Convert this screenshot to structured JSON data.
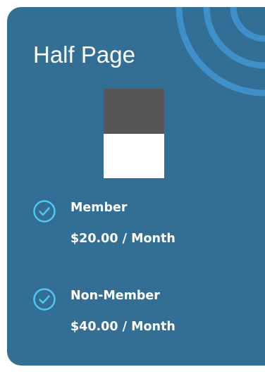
{
  "card": {
    "title": "Half Page",
    "colors": {
      "background": "#336f94",
      "accent": "#4fc6ef",
      "rings": "#3f8fc8",
      "preview_filled": "#555555",
      "preview_blank": "#ffffff"
    },
    "preview": {
      "filled_fraction": 0.5
    },
    "prices": [
      {
        "tier": "Member",
        "price": "$20.00 / Month",
        "icon": "check-circle-icon"
      },
      {
        "tier": "Non-Member",
        "price": "$40.00 / Month",
        "icon": "check-circle-icon"
      }
    ]
  }
}
